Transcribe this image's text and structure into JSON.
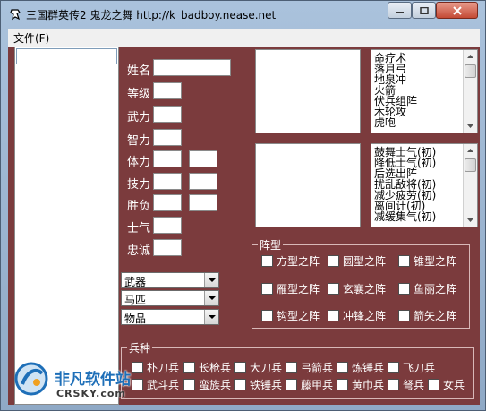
{
  "window": {
    "title": "三国群英传2 鬼龙之舞 http://k_badboy.nease.net"
  },
  "menu": {
    "file_label": "文件(F)"
  },
  "general_list": {
    "search_value": ""
  },
  "stats": {
    "name_label": "姓名",
    "level_label": "等级",
    "force_label": "武力",
    "intellect_label": "智力",
    "stamina_label": "体力",
    "skill_label": "技力",
    "winloss_label": "胜负",
    "morale_label": "士气",
    "loyalty_label": "忠诚"
  },
  "selects": {
    "weapon": "武器",
    "horse": "马匹",
    "item": "物品"
  },
  "skills_top": [
    "命疗术",
    "落月弓",
    "地泉冲",
    "火箭",
    "伏兵组阵",
    "木轮攻",
    "虎咆"
  ],
  "skills_bottom": [
    "鼓舞士气(初)",
    "降低士气(初)",
    "后选出阵",
    "扰乱敌将(初)",
    "减少疲劳(初)",
    "离间计(初)",
    "减缓集气(初)"
  ],
  "formation": {
    "title": "阵型",
    "options": [
      "方型之阵",
      "圆型之阵",
      "锥型之阵",
      "雁型之阵",
      "玄襄之阵",
      "鱼丽之阵",
      "钩型之阵",
      "冲锋之阵",
      "箭矢之阵"
    ]
  },
  "troops": {
    "title": "兵种",
    "row1": [
      "朴刀兵",
      "长枪兵",
      "大刀兵",
      "弓箭兵",
      "炼锤兵",
      "飞刀兵"
    ],
    "row2": [
      "武斗兵",
      "蛮族兵",
      "铁锤兵",
      "藤甲兵",
      "黄巾兵",
      "弩兵",
      "女兵"
    ]
  },
  "watermark": {
    "cn": "非凡软件站",
    "en": "CRSKY.com"
  },
  "colors": {
    "client_bg": "#7b3b3d",
    "titlebar": "#9bb5d2",
    "watermark_blue": "#1e6fb8"
  }
}
